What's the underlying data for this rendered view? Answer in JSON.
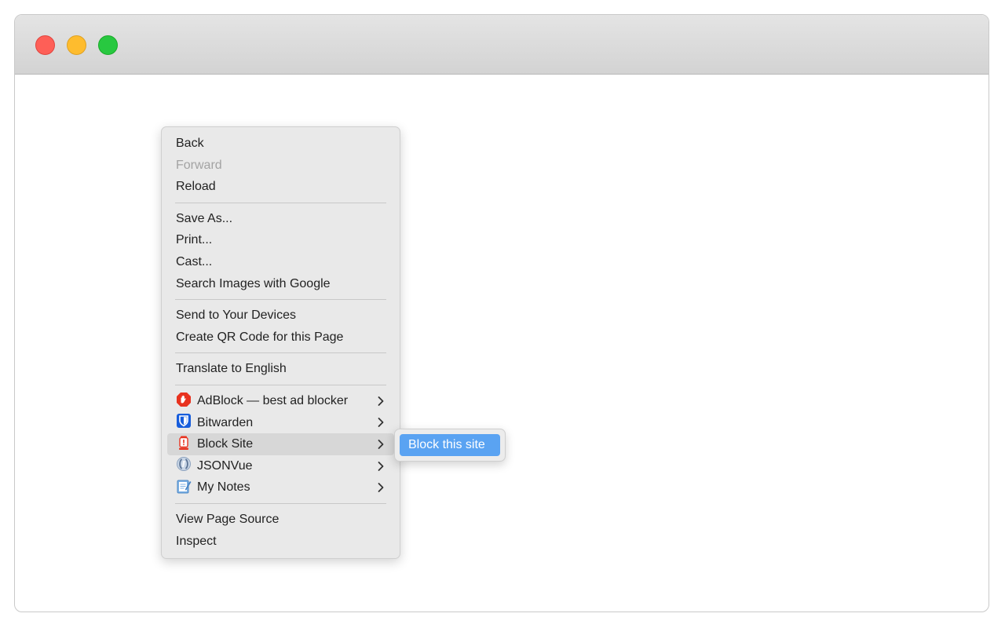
{
  "window": {
    "controls": {
      "close": "close-button",
      "minimize": "minimize-button",
      "zoom": "zoom-button"
    }
  },
  "context_menu": {
    "group1": [
      {
        "label": "Back",
        "enabled": true
      },
      {
        "label": "Forward",
        "enabled": false
      },
      {
        "label": "Reload",
        "enabled": true
      }
    ],
    "group2": [
      {
        "label": "Save As..."
      },
      {
        "label": "Print..."
      },
      {
        "label": "Cast..."
      },
      {
        "label": "Search Images with Google"
      }
    ],
    "group3": [
      {
        "label": "Send to Your Devices"
      },
      {
        "label": "Create QR Code for this Page"
      }
    ],
    "group4": [
      {
        "label": "Translate to English"
      }
    ],
    "extensions": [
      {
        "label": "AdBlock — best ad blocker",
        "icon": "adblock-icon",
        "has_submenu": true
      },
      {
        "label": "Bitwarden",
        "icon": "bitwarden-icon",
        "has_submenu": true
      },
      {
        "label": "Block Site",
        "icon": "block-site-icon",
        "has_submenu": true,
        "highlighted": true
      },
      {
        "label": "JSONVue",
        "icon": "jsonvue-icon",
        "has_submenu": true
      },
      {
        "label": "My Notes",
        "icon": "my-notes-icon",
        "has_submenu": true
      }
    ],
    "group6": [
      {
        "label": "View Page Source"
      },
      {
        "label": "Inspect"
      }
    ]
  },
  "submenu": {
    "items": [
      {
        "label": "Block this site",
        "highlighted": true
      }
    ]
  },
  "colors": {
    "close": "#fe5f57",
    "minimize": "#febc2e",
    "zoom": "#28c840",
    "highlight": "#5aa3f2"
  }
}
